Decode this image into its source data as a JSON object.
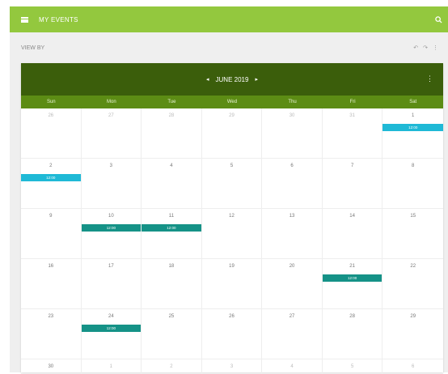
{
  "app": {
    "title": "MY EVENTS"
  },
  "subbar": {
    "crumb": "VIEW BY",
    "tools": [
      "↶",
      "↷",
      "⋮"
    ]
  },
  "calendar": {
    "month_label": "JUNE 2019",
    "prev_icon": "◂",
    "next_icon": "▸",
    "more_icon": "⋮",
    "days": [
      "Sun",
      "Mon",
      "Tue",
      "Wed",
      "Thu",
      "Fri",
      "Sat"
    ],
    "weeks": [
      [
        {
          "d": "26",
          "o": true
        },
        {
          "d": "27",
          "o": true
        },
        {
          "d": "28",
          "o": true
        },
        {
          "d": "29",
          "o": true
        },
        {
          "d": "30",
          "o": true
        },
        {
          "d": "31",
          "o": true
        },
        {
          "d": "1",
          "e": "12:00",
          "c": "cyan"
        }
      ],
      [
        {
          "d": "2",
          "e": "12:00",
          "c": "cyan"
        },
        {
          "d": "3"
        },
        {
          "d": "4"
        },
        {
          "d": "5"
        },
        {
          "d": "6"
        },
        {
          "d": "7"
        },
        {
          "d": "8"
        }
      ],
      [
        {
          "d": "9"
        },
        {
          "d": "10",
          "e": "12:00",
          "c": "teal"
        },
        {
          "d": "11",
          "e": "12:00",
          "c": "teal"
        },
        {
          "d": "12"
        },
        {
          "d": "13"
        },
        {
          "d": "14"
        },
        {
          "d": "15"
        }
      ],
      [
        {
          "d": "16"
        },
        {
          "d": "17"
        },
        {
          "d": "18"
        },
        {
          "d": "19"
        },
        {
          "d": "20"
        },
        {
          "d": "21",
          "e": "12:00",
          "c": "teal"
        },
        {
          "d": "22"
        }
      ],
      [
        {
          "d": "23"
        },
        {
          "d": "24",
          "e": "12:00",
          "c": "teal"
        },
        {
          "d": "25"
        },
        {
          "d": "26"
        },
        {
          "d": "27"
        },
        {
          "d": "28"
        },
        {
          "d": "29"
        }
      ],
      [
        {
          "d": "30"
        },
        {
          "d": "1",
          "o": true
        },
        {
          "d": "2",
          "o": true
        },
        {
          "d": "3",
          "o": true
        },
        {
          "d": "4",
          "o": true
        },
        {
          "d": "5",
          "o": true
        },
        {
          "d": "6",
          "o": true
        }
      ]
    ]
  },
  "colors": {
    "appbar": "#93c83e",
    "header": "#3b5e0b",
    "dow": "#5c8c14",
    "event_teal": "#159287",
    "event_cyan": "#1fb9d6"
  }
}
